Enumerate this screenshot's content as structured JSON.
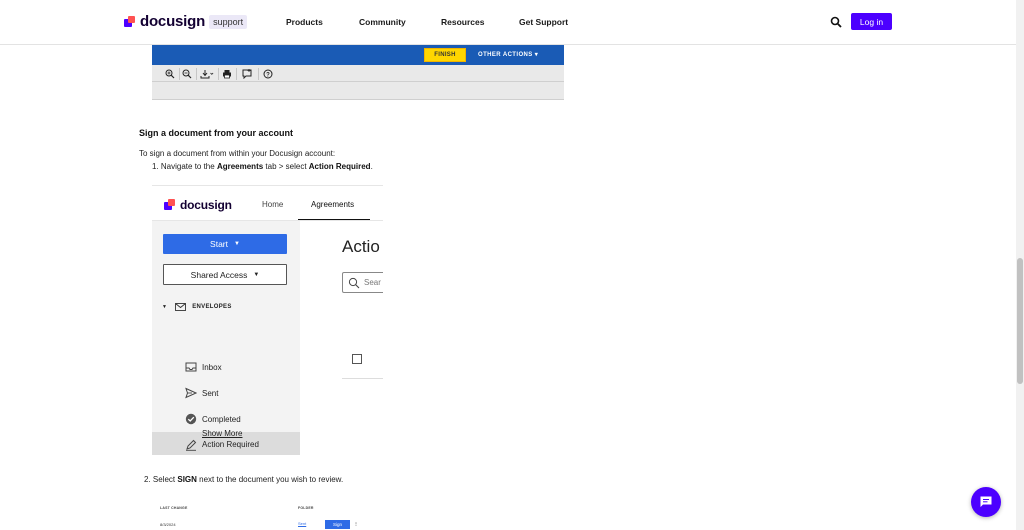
{
  "header": {
    "logo_text": "docusign",
    "logo_tag": "support",
    "nav": [
      "Products",
      "Community",
      "Resources",
      "Get Support"
    ],
    "login_label": "Log in"
  },
  "signing_toolbar": {
    "finish_label": "FINISH",
    "other_actions_label": "OTHER ACTIONS ▾",
    "tools": [
      "zoom-in-icon",
      "zoom-out-icon",
      "download-icon",
      "print-icon",
      "comment-icon",
      "help-icon"
    ]
  },
  "article": {
    "heading": "Sign a document from your account",
    "intro": "To sign a document from within your Docusign account:",
    "step1": {
      "prefix": "1. Navigate to the ",
      "b1": "Agreements",
      "mid": " tab > select ",
      "b2": "Action Required",
      "suffix": "."
    },
    "step2": {
      "prefix": "2. Select ",
      "b1": "SIGN",
      "suffix": " next to the document you wish to review."
    }
  },
  "app_shot": {
    "logo_text": "docusign",
    "tabs": [
      "Home",
      "Agreements"
    ],
    "active_tab": "Agreements",
    "start_label": "Start",
    "shared_label": "Shared Access",
    "envelopes_label": "ENVELOPES",
    "items": [
      "Inbox",
      "Sent",
      "Completed",
      "Action Required"
    ],
    "active_item": "Action Required",
    "show_more": "Show More",
    "main_title": "Actio",
    "search_placeholder": "Sear"
  },
  "list_shot": {
    "headers": [
      "LAST CHANGE",
      "FOLDER"
    ],
    "date": "8/3/2024",
    "folder": "Sent",
    "sign_label": "Sign"
  },
  "colors": {
    "brand": "#4c00ff",
    "toolbar_blue": "#1a5bb5",
    "finish_yellow": "#ffd600",
    "start_blue": "#2e6be6"
  }
}
